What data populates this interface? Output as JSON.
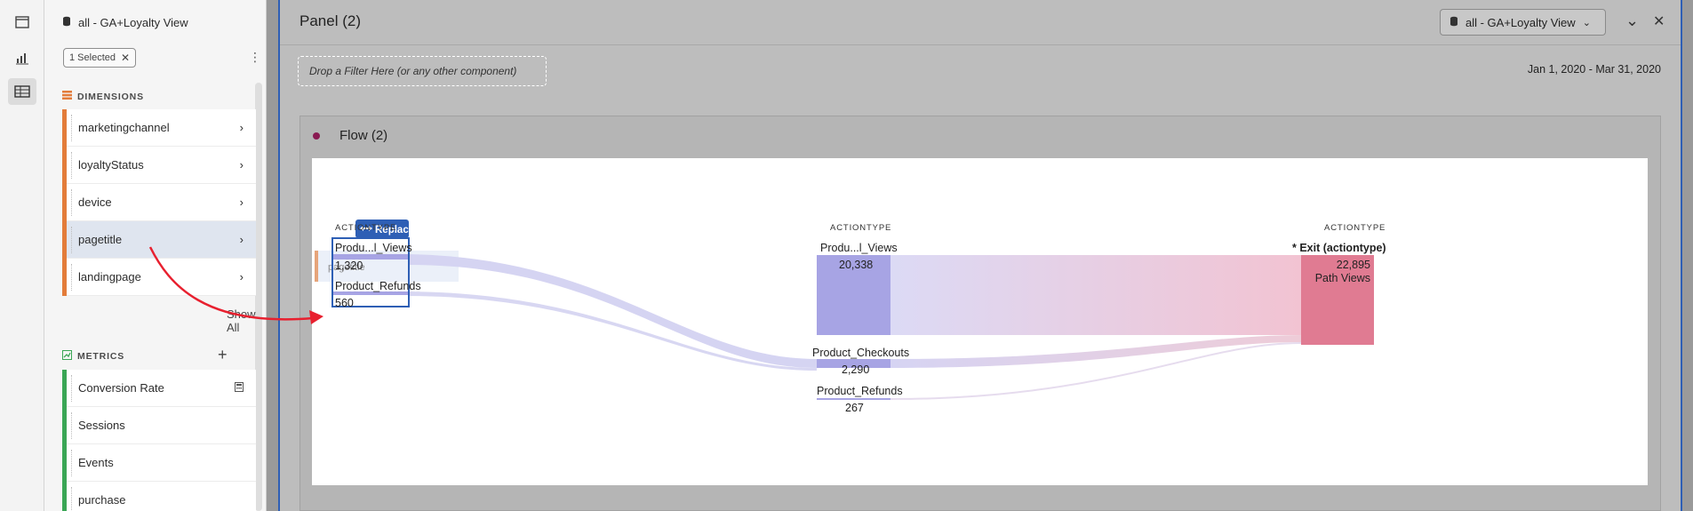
{
  "rail": {
    "icons": [
      "panel-icon",
      "bar-chart-icon",
      "components-icon"
    ]
  },
  "components": {
    "datasource": "all - GA+Loyalty View",
    "chip_label": "1 Selected",
    "dimensions_header": "DIMENSIONS",
    "dimensions": [
      "marketingchannel",
      "loyaltyStatus",
      "device",
      "pagetitle",
      "landingpage"
    ],
    "show_all": "Show All",
    "metrics_header": "METRICS",
    "metrics": [
      "Conversion Rate",
      "Sessions",
      "Events",
      "purchase"
    ]
  },
  "panel": {
    "title": "Panel (2)",
    "datasource": "all - GA+Loyalty View",
    "drop_filter": "Drop a Filter Here (or any other component)",
    "date_range": "Jan 1, 2020 - Mar 31, 2020"
  },
  "flow": {
    "title": "Flow (2)",
    "replace_label": "Replace",
    "drag_ghost": "pagetitle",
    "columns": [
      {
        "header": "ACTIONTYPE",
        "nodes": [
          {
            "label": "Produ...l_Views",
            "value": "1,320"
          },
          {
            "label": "Product_Refunds",
            "value": "560"
          }
        ]
      },
      {
        "header": "ACTIONTYPE",
        "nodes": [
          {
            "label": "Produ...l_Views",
            "value": "20,338"
          },
          {
            "label": "Product_Checkouts",
            "value": "2,290"
          },
          {
            "label": "Product_Refunds",
            "value": "267"
          }
        ]
      },
      {
        "header": "ACTIONTYPE",
        "nodes": [
          {
            "label": "* Exit (actiontype)",
            "value": "22,895",
            "sublabel": "Path Views"
          }
        ]
      }
    ]
  },
  "colors": {
    "accent": "#2e5fb5",
    "dimension": "#e37c3a",
    "metric": "#3aa655",
    "node": "#a7a4e4",
    "exit": "#e07b92",
    "arrow": "#e8202f"
  }
}
